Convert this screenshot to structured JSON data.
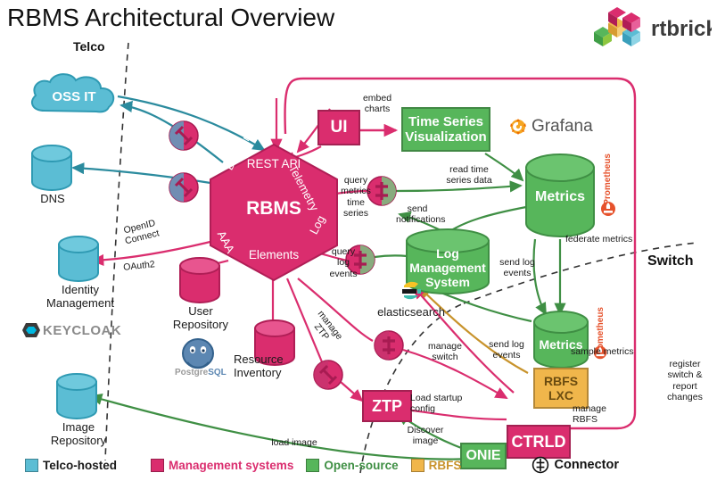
{
  "page": {
    "title": "RBMS Architectural Overview",
    "brand": "rtbrick"
  },
  "colors": {
    "telco": "#5BBDD4",
    "management": "#DA2D6E",
    "opensource": "#57B65B",
    "rbfs": "#F0B64B",
    "prometheus": "#E6522C",
    "text": "#1a1a1a"
  },
  "zones": [
    {
      "name": "telco",
      "label": "Telco"
    },
    {
      "name": "switch",
      "label": "Switch"
    }
  ],
  "nodes": [
    {
      "id": "oss",
      "label": "OSS IT",
      "kind": "cloud",
      "group": "telco"
    },
    {
      "id": "dns",
      "label": "DNS",
      "kind": "cylinder",
      "group": "telco",
      "caption": "DNS"
    },
    {
      "id": "idm",
      "label": "Identity Management",
      "kind": "cylinder",
      "group": "telco",
      "caption": "Identity\nManagement",
      "logo": "KEYCLOAK"
    },
    {
      "id": "imagerepo",
      "label": "Image Repository",
      "kind": "cylinder",
      "group": "telco",
      "caption": "Image\nRepository"
    },
    {
      "id": "rbms",
      "label": "RBMS",
      "kind": "hexagon",
      "group": "management"
    },
    {
      "id": "userrepo",
      "label": "User Repository",
      "kind": "cylinder",
      "group": "management",
      "caption": "User\nRepository",
      "logo": "PostgreSQL"
    },
    {
      "id": "resinv",
      "label": "Resource Inventory",
      "kind": "cylinder",
      "group": "management",
      "caption": "Resource\nInventory"
    },
    {
      "id": "ui",
      "label": "UI",
      "kind": "box",
      "group": "management"
    },
    {
      "id": "ztp",
      "label": "ZTP",
      "kind": "box",
      "group": "management"
    },
    {
      "id": "ctrld",
      "label": "CTRLD",
      "kind": "box",
      "group": "management"
    },
    {
      "id": "tsv",
      "label": "Time Series Visualization",
      "kind": "box",
      "group": "opensource",
      "logo": "Grafana"
    },
    {
      "id": "metrics1",
      "label": "Metrics",
      "kind": "cylinder",
      "group": "opensource",
      "logo": "Prometheus"
    },
    {
      "id": "lms",
      "label": "Log Management System",
      "kind": "cylinder",
      "group": "opensource",
      "logo": "elasticsearch"
    },
    {
      "id": "metrics2",
      "label": "Metrics",
      "kind": "cylinder",
      "group": "opensource",
      "logo": "Prometheus"
    },
    {
      "id": "onie",
      "label": "ONIE",
      "kind": "box",
      "group": "opensource"
    },
    {
      "id": "rbfslxc",
      "label": "RBFS LXC",
      "kind": "box",
      "group": "rbfs"
    }
  ],
  "hexagon": {
    "center_label": "RBMS",
    "edges": [
      {
        "side": "top",
        "label": "REST API"
      },
      {
        "side": "upper-right",
        "label": "Telemetry"
      },
      {
        "side": "lower-right",
        "label": "Log"
      },
      {
        "side": "bottom",
        "label": "Elements"
      },
      {
        "side": "lower-left",
        "label": "AAA"
      },
      {
        "side": "upper-left",
        "label": "Domain Events"
      }
    ]
  },
  "edge_labels": [
    {
      "id": "embed-charts",
      "text": "embed charts"
    },
    {
      "id": "query-metrics",
      "text": "query metrics time series"
    },
    {
      "id": "read-time-series",
      "text": "read time series data"
    },
    {
      "id": "send-notifications",
      "text": "send notifications"
    },
    {
      "id": "query-log-events",
      "text": "query log events"
    },
    {
      "id": "send-log-events-1",
      "text": "send log events"
    },
    {
      "id": "send-log-events-2",
      "text": "send log events"
    },
    {
      "id": "federate-metrics",
      "text": "federate metrics"
    },
    {
      "id": "sample-metrics",
      "text": "sample metrics"
    },
    {
      "id": "manage-rbfs",
      "text": "manage RBFS"
    },
    {
      "id": "manage-ztp",
      "text": "manage ZTP"
    },
    {
      "id": "manage-switch",
      "text": "manage switch"
    },
    {
      "id": "load-startup",
      "text": "Load startup config"
    },
    {
      "id": "discover-image",
      "text": "Discover image"
    },
    {
      "id": "load-image",
      "text": "load image"
    },
    {
      "id": "openid-connect",
      "text": "OpenID Connect"
    },
    {
      "id": "oauth2",
      "text": "OAuth2"
    },
    {
      "id": "register-switch",
      "text": "register switch & report changes"
    }
  ],
  "logos": {
    "grafana": "Grafana",
    "prometheus": "Prometheus",
    "elasticsearch": "elasticsearch",
    "keycloak": "KEYCLOAK",
    "postgresql": "PostgreSQL"
  },
  "legend": {
    "items": [
      {
        "label": "Telco-hosted",
        "color": "#5BBDD4"
      },
      {
        "label": "Management systems",
        "color": "#DA2D6E"
      },
      {
        "label": "Open-source",
        "color": "#57B65B"
      },
      {
        "label": "RBFS",
        "color": "#F0B64B"
      }
    ],
    "connector_label": "Connector"
  }
}
